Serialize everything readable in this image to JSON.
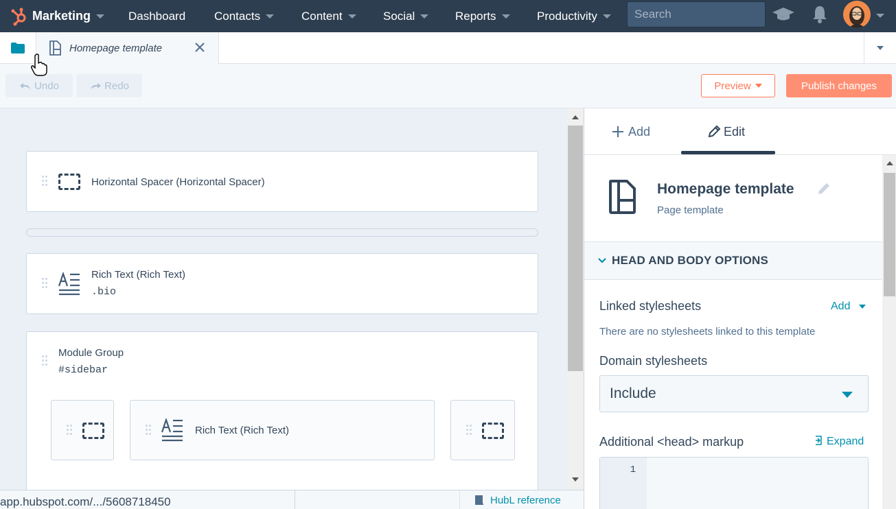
{
  "topnav": {
    "brand": "Marketing",
    "items": [
      "Dashboard",
      "Contacts",
      "Content",
      "Social",
      "Reports",
      "Productivity"
    ],
    "search_placeholder": "Search",
    "icons": [
      "hubspot-sprocket-icon",
      "academy-icon",
      "notifications-icon",
      "avatar"
    ]
  },
  "tabbar": {
    "open_tab": "Homepage template"
  },
  "toolbar": {
    "undo": "Undo",
    "redo": "Redo",
    "preview": "Preview",
    "publish": "Publish changes"
  },
  "canvas": {
    "modules": [
      {
        "title": "Horizontal Spacer (Horizontal Spacer)"
      },
      {
        "title": "Rich Text (Rich Text)",
        "sub": ".bio"
      },
      {
        "title": "Module Group",
        "sub": "#sidebar"
      }
    ],
    "group_children": [
      {
        "title": "Rich Text (Rich Text)"
      }
    ]
  },
  "statusbar": {
    "url": "app.hubspot.com/.../5608718450",
    "hubl": "HubL reference"
  },
  "panel": {
    "tabs": {
      "add": "Add",
      "edit": "Edit"
    },
    "template_title": "Homepage template",
    "template_type": "Page template",
    "section": "HEAD AND BODY OPTIONS",
    "linked_stylesheets": "Linked stylesheets",
    "add_link": "Add",
    "no_stylesheets": "There are no stylesheets linked to this template",
    "domain_stylesheets": "Domain stylesheets",
    "domain_value": "Include",
    "additional_head": "Additional <head> markup",
    "expand": "Expand",
    "line_number": "1"
  },
  "colors": {
    "nav_bg": "#2d3e50",
    "accent_orange": "#ff7a59",
    "link_teal": "#0091ae",
    "text": "#33475b"
  }
}
